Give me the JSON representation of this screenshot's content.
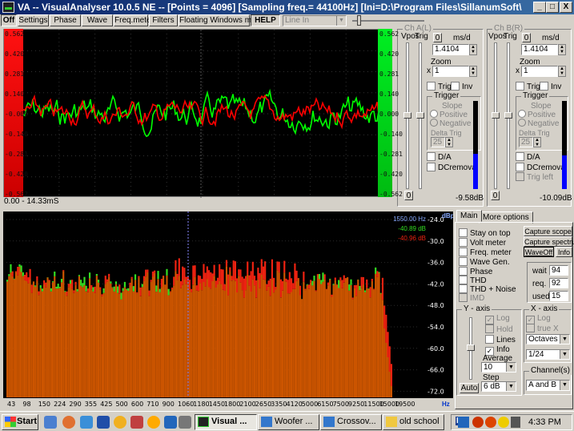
{
  "window": {
    "title": "VA -- VisualAnalyser 10.0.5 NE --  [Points = 4096]  [Sampling freq.= 44100Hz]  [Ini=D:\\Program Files\\SillanumSoft\\VA10...",
    "controls": [
      "_",
      "□",
      "X"
    ]
  },
  "toolbar": {
    "buttons": [
      "Off",
      "Settings",
      "Phase",
      "Wave",
      "Freq.meter",
      "Filters",
      "Floating Windows mode",
      "HELP"
    ],
    "input_select": "Line In"
  },
  "scope": {
    "left_labels": [
      "0.562",
      "0.420",
      "0.281",
      "0.140",
      "-0.000",
      "-0.140",
      "-0.281",
      "-0.420",
      "-0.562"
    ],
    "right_labels": [
      "0.562",
      "0.420",
      "0.281",
      "0.140",
      "0.000",
      "-0.140",
      "-0.281",
      "-0.420",
      "-0.562"
    ],
    "time_range": "0.00 - 14.33mS",
    "colors": {
      "ch_a": "#00ff00",
      "ch_b": "#ff0000",
      "left_bar": "#ff1111",
      "right_bar": "#00dd22",
      "background": "#000000"
    }
  },
  "channel_a": {
    "caption": "Ch A(L)",
    "vpos_label": "Vpos",
    "trig_label": "Trig",
    "zero_button": "0",
    "ms_div_label": "ms/d",
    "ms_div_value": "1.4104",
    "zoom_label": "Zoom",
    "zoom_x": "x",
    "zoom_value": "1",
    "trig_check": "Trig",
    "inv_check": "Inv",
    "trigger_caption": "Trigger",
    "slope_label": "Slope",
    "positive": "Positive",
    "negative": "Negative",
    "delta_label": "Delta Trig",
    "delta_value": "25",
    "da_check": "D/A",
    "dc_check": "DCremoval",
    "bottom_zero": "0",
    "level": "-9.58dB",
    "meter_fill": 0.4
  },
  "channel_b": {
    "caption": "Ch B(R)",
    "vpos_label": "Vpos",
    "trig_label": "Trig",
    "zero_button": "0",
    "ms_div_label": "ms/d",
    "ms_div_value": "1.4104",
    "zoom_label": "Zoom",
    "zoom_x": "x",
    "zoom_value": "1",
    "trig_check": "Trig",
    "inv_check": "Inv",
    "trigger_caption": "Trigger",
    "slope_label": "Slope",
    "positive": "Positive",
    "negative": "Negative",
    "delta_label": "Delta Trig",
    "delta_value": "25",
    "da_check": "D/A",
    "dc_check": "DCremoval",
    "trig_left_check": "Trig left",
    "bottom_zero": "0",
    "level": "-10.09dB",
    "meter_fill": 0.38
  },
  "spectrum": {
    "unit": "dBpp",
    "y_labels": [
      "-24.0",
      "-30.0",
      "-36.0",
      "-42.0",
      "-48.0",
      "-54.0",
      "-60.0",
      "-66.0",
      "-72.0"
    ],
    "x_labels": [
      "43",
      "98",
      "150",
      "224",
      "290",
      "355",
      "425",
      "500",
      "600",
      "710",
      "900",
      "1060",
      "1180",
      "1450",
      "1800",
      "2100",
      "2650",
      "3350",
      "4120",
      "5000",
      "6150",
      "7500",
      "9250",
      "11500",
      "15000",
      "19500"
    ],
    "x_unit": "Hz",
    "cursor_freq": "1550.00 Hz",
    "cursor_a": "-40.89 dB",
    "cursor_b": "-40.96 dB",
    "colors": {
      "ch_a": "#33dd22",
      "ch_b": "#ee2211",
      "overlap": "#cc5500",
      "cursor": "#8888ff"
    }
  },
  "main_panel": {
    "tabs": [
      "Main",
      "More options"
    ],
    "checks": [
      {
        "label": "Stay on top",
        "checked": false,
        "enabled": true
      },
      {
        "label": "Volt meter",
        "checked": false,
        "enabled": true
      },
      {
        "label": "Freq. meter",
        "checked": false,
        "enabled": true
      },
      {
        "label": "Wave Gen.",
        "checked": false,
        "enabled": true
      },
      {
        "label": "Phase",
        "checked": false,
        "enabled": true
      },
      {
        "label": "THD",
        "checked": false,
        "enabled": true
      },
      {
        "label": "THD + Noise",
        "checked": false,
        "enabled": true
      },
      {
        "label": "IMD",
        "checked": false,
        "enabled": false
      }
    ],
    "capture_scope": "Capture scope",
    "capture_spectrum": "Capture spectrum",
    "wave_off": "WaveOff",
    "info": "Info",
    "wait_label": "wait",
    "wait_value": "94",
    "req_label": "req.",
    "req_value": "92",
    "used_label": "used",
    "used_value": "15"
  },
  "y_axis": {
    "caption": "Y - axis",
    "log": "Log",
    "hold": "Hold",
    "lines": "Lines",
    "info": "Info",
    "average_label": "Average",
    "average_value": "10",
    "step_label": "Step",
    "step_value": "6 dB",
    "auto_button": "Auto"
  },
  "x_axis": {
    "caption": "X - axis",
    "log": "Log",
    "true_x": "true X",
    "scale_value": "Octaves",
    "fraction_value": "1/24"
  },
  "channels": {
    "caption": "Channel(s)",
    "value": "A and B"
  },
  "taskbar": {
    "start": "Start",
    "tasks": [
      "Visual ...",
      "Woofer ...",
      "Crossov...",
      "old school"
    ],
    "lang": "EN",
    "clock": "4:33 PM"
  }
}
